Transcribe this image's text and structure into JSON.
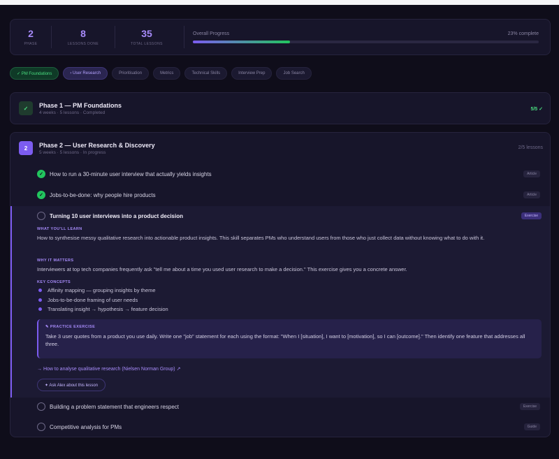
{
  "stats": {
    "items": [
      {
        "value": "2",
        "label": "PHASE"
      },
      {
        "value": "8",
        "label": "LESSONS DONE"
      },
      {
        "value": "35",
        "label": "TOTAL LESSONS"
      }
    ],
    "progress_label": "Overall Progress",
    "progress_text": "23% complete",
    "progress_fraction": 0.28
  },
  "tabs": [
    {
      "label": "✓ PM Foundations",
      "state": "done"
    },
    {
      "label": "› User Research",
      "state": "active"
    },
    {
      "label": "Prioritisation",
      "state": "idle"
    },
    {
      "label": "Metrics",
      "state": "idle"
    },
    {
      "label": "Technical Skills",
      "state": "idle"
    },
    {
      "label": "Interview Prep",
      "state": "idle"
    },
    {
      "label": "Job Search",
      "state": "idle"
    }
  ],
  "phase1": {
    "badge": "✓",
    "title": "Phase 1 — PM Foundations",
    "subtitle": "4 weeks · 5 lessons · Completed",
    "status": "5/5 ✓"
  },
  "phase2": {
    "badge": "2",
    "title": "Phase 2 — User Research & Discovery",
    "subtitle": "5 weeks · 5 lessons · In progress",
    "status": "2/5 lessons",
    "lessons": [
      {
        "title": "How to run a 30-minute user interview that actually yields insights",
        "tag": "Article",
        "done": true
      },
      {
        "title": "Jobs-to-be-done: why people hire products",
        "tag": "Article",
        "done": true
      },
      {
        "title": "Turning 10 user interviews into a product decision",
        "tag": "Exercise",
        "done": false
      },
      {
        "title": "Building a problem statement that engineers respect",
        "tag": "Exercise",
        "done": false
      },
      {
        "title": "Competitive analysis for PMs",
        "tag": "Guide",
        "done": false
      }
    ],
    "expanded": {
      "learn_label": "WHAT YOU'LL LEARN",
      "learn_text": "How to synthesise messy qualitative research into actionable product insights. This skill separates PMs who understand users from those who just collect data without knowing what to do with it.",
      "why_label": "WHY IT MATTERS",
      "why_text": "Interviewers at top tech companies frequently ask \"tell me about a time you used user research to make a decision.\" This exercise gives you a concrete answer.",
      "concepts_label": "KEY CONCEPTS",
      "concepts": [
        "Affinity mapping — grouping insights by theme",
        "Jobs-to-be-done framing of user needs",
        "Translating insight → hypothesis → feature decision"
      ],
      "exercise_label": "✎ PRACTICE EXERCISE",
      "exercise_text": "Take 3 user quotes from a product you use daily. Write one \"job\" statement for each using the format: \"When I [situation], I want to [motivation], so I can [outcome].\" Then identify one feature that addresses all three.",
      "resource": "→ How to analyse qualitative research (Nielsen Norman Group) ↗",
      "ask_button": "✦ Ask Alex about this lesson"
    }
  },
  "colors": {
    "background": "#0f0d1a",
    "card": "#17152a",
    "accent": "#7c5cf0",
    "success": "#22c55e"
  }
}
